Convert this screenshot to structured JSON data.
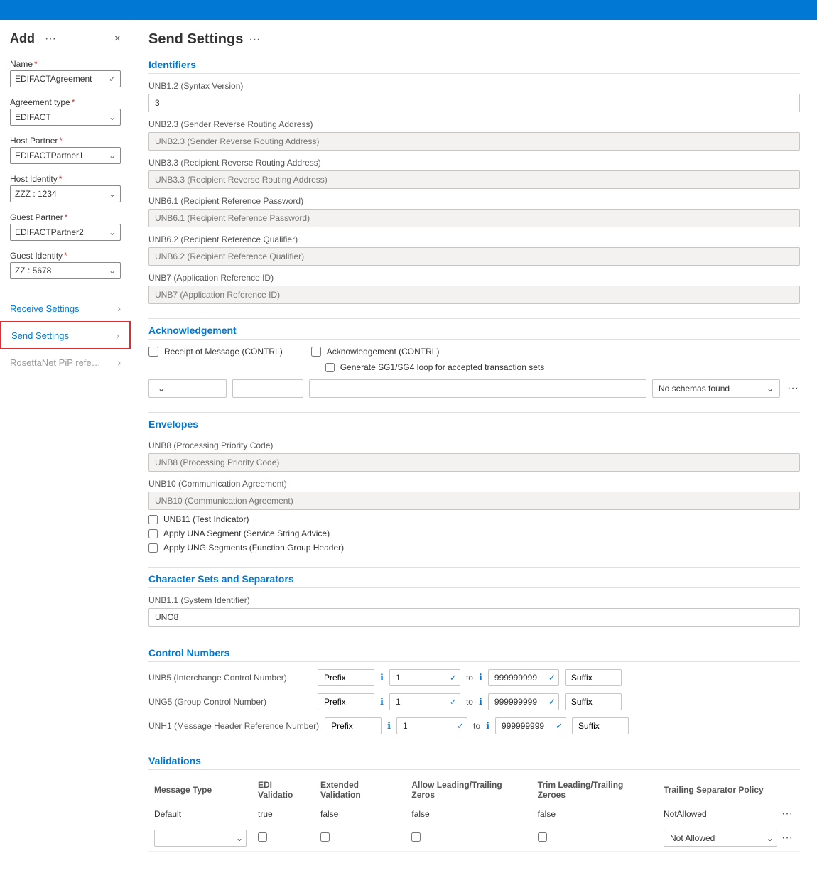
{
  "topBar": {
    "color": "#0078d4"
  },
  "sidebar": {
    "title": "Add",
    "ellipsis": "···",
    "closeLabel": "×",
    "nameLabel": "Name",
    "nameRequired": "*",
    "nameValue": "EDIFACTAgreement",
    "agreementTypeLabel": "Agreement type",
    "agreementTypeRequired": "*",
    "agreementTypeValue": "EDIFACT",
    "hostPartnerLabel": "Host Partner",
    "hostPartnerRequired": "*",
    "hostPartnerValue": "EDIFACTPartner1",
    "hostIdentityLabel": "Host Identity",
    "hostIdentityRequired": "*",
    "hostIdentityValue": "ZZZ : 1234",
    "guestPartnerLabel": "Guest Partner",
    "guestPartnerRequired": "*",
    "guestPartnerValue": "EDIFACTPartner2",
    "guestIdentityLabel": "Guest Identity",
    "guestIdentityRequired": "*",
    "guestIdentityValue": "ZZ : 5678",
    "navItems": [
      {
        "id": "receive-settings",
        "label": "Receive Settings",
        "active": false,
        "disabled": false
      },
      {
        "id": "send-settings",
        "label": "Send Settings",
        "active": true,
        "disabled": false
      },
      {
        "id": "rosettanet",
        "label": "RosettaNet PiP referen",
        "active": false,
        "disabled": true
      }
    ]
  },
  "main": {
    "title": "Send Settings",
    "ellipsis": "···",
    "sections": {
      "identifiers": {
        "title": "Identifiers",
        "fields": [
          {
            "id": "unb12",
            "label": "UNB1.2 (Syntax Version)",
            "value": "3",
            "placeholder": ""
          },
          {
            "id": "unb23",
            "label": "UNB2.3 (Sender Reverse Routing Address)",
            "value": "",
            "placeholder": "UNB2.3 (Sender Reverse Routing Address)"
          },
          {
            "id": "unb33",
            "label": "UNB3.3 (Recipient Reverse Routing Address)",
            "value": "",
            "placeholder": "UNB3.3 (Recipient Reverse Routing Address)"
          },
          {
            "id": "unb61",
            "label": "UNB6.1 (Recipient Reference Password)",
            "value": "",
            "placeholder": "UNB6.1 (Recipient Reference Password)"
          },
          {
            "id": "unb62",
            "label": "UNB6.2 (Recipient Reference Qualifier)",
            "value": "",
            "placeholder": "UNB6.2 (Recipient Reference Qualifier)"
          },
          {
            "id": "unb7",
            "label": "UNB7 (Application Reference ID)",
            "value": "",
            "placeholder": "UNB7 (Application Reference ID)"
          }
        ]
      },
      "acknowledgement": {
        "title": "Acknowledgement",
        "receiptOfMessage": "Receipt of Message (CONTRL)",
        "acknowledgementContrl": "Acknowledgement (CONTRL)",
        "generateSG": "Generate SG1/SG4 loop for accepted transaction sets",
        "schemaDropdownValue": "",
        "schemaInput1": "",
        "schemaInput2": "",
        "schemasFoundLabel": "No schemas found",
        "ellipsis": "···"
      },
      "envelopes": {
        "title": "Envelopes",
        "fields": [
          {
            "id": "unb8",
            "label": "UNB8 (Processing Priority Code)",
            "placeholder": "UNB8 (Processing Priority Code)"
          },
          {
            "id": "unb10",
            "label": "UNB10 (Communication Agreement)",
            "placeholder": "UNB10 (Communication Agreement)"
          }
        ],
        "checkboxes": [
          {
            "id": "unb11",
            "label": "UNB11 (Test Indicator)"
          },
          {
            "id": "una",
            "label": "Apply UNA Segment (Service String Advice)"
          },
          {
            "id": "ung",
            "label": "Apply UNG Segments (Function Group Header)"
          }
        ]
      },
      "charSets": {
        "title": "Character Sets and Separators",
        "systemIdentifierLabel": "UNB1.1 (System Identifier)",
        "systemIdentifierValue": "UNO8"
      },
      "controlNumbers": {
        "title": "Control Numbers",
        "rows": [
          {
            "id": "unb5",
            "label": "UNB5 (Interchange Control Number)",
            "prefix": "Prefix",
            "numberFrom": "1",
            "to": "to",
            "numberTo": "999999999",
            "suffix": "Suffix"
          },
          {
            "id": "ung5",
            "label": "UNG5 (Group Control Number)",
            "prefix": "Prefix",
            "numberFrom": "1",
            "to": "to",
            "numberTo": "999999999",
            "suffix": "Suffix"
          },
          {
            "id": "unh1",
            "label": "UNH1 (Message Header Reference Number)",
            "prefix": "Prefix",
            "numberFrom": "1",
            "to": "to",
            "numberTo": "999999999",
            "suffix": "Suffix"
          }
        ]
      },
      "validations": {
        "title": "Validations",
        "columns": [
          "Message Type",
          "EDI Validation",
          "Extended Validation",
          "Allow Leading/Trailing Zeros",
          "Trim Leading/Trailing Zeroes",
          "Trailing Separator Policy"
        ],
        "defaultRow": {
          "messageType": "Default",
          "ediValidation": "true",
          "extendedValidation": "false",
          "allowLeading": "false",
          "trimLeading": "false",
          "trailingSeparator": "NotAllowed"
        },
        "editRow": {
          "messageTypeDropdown": "",
          "ediValidationCheck": false,
          "extendedValidationCheck": false,
          "allowLeadingCheck": false,
          "trimLeadingCheck": false,
          "trailingSeparatorValue": "Not Allowed"
        },
        "ellipsis1": "···",
        "ellipsis2": "···"
      }
    }
  }
}
